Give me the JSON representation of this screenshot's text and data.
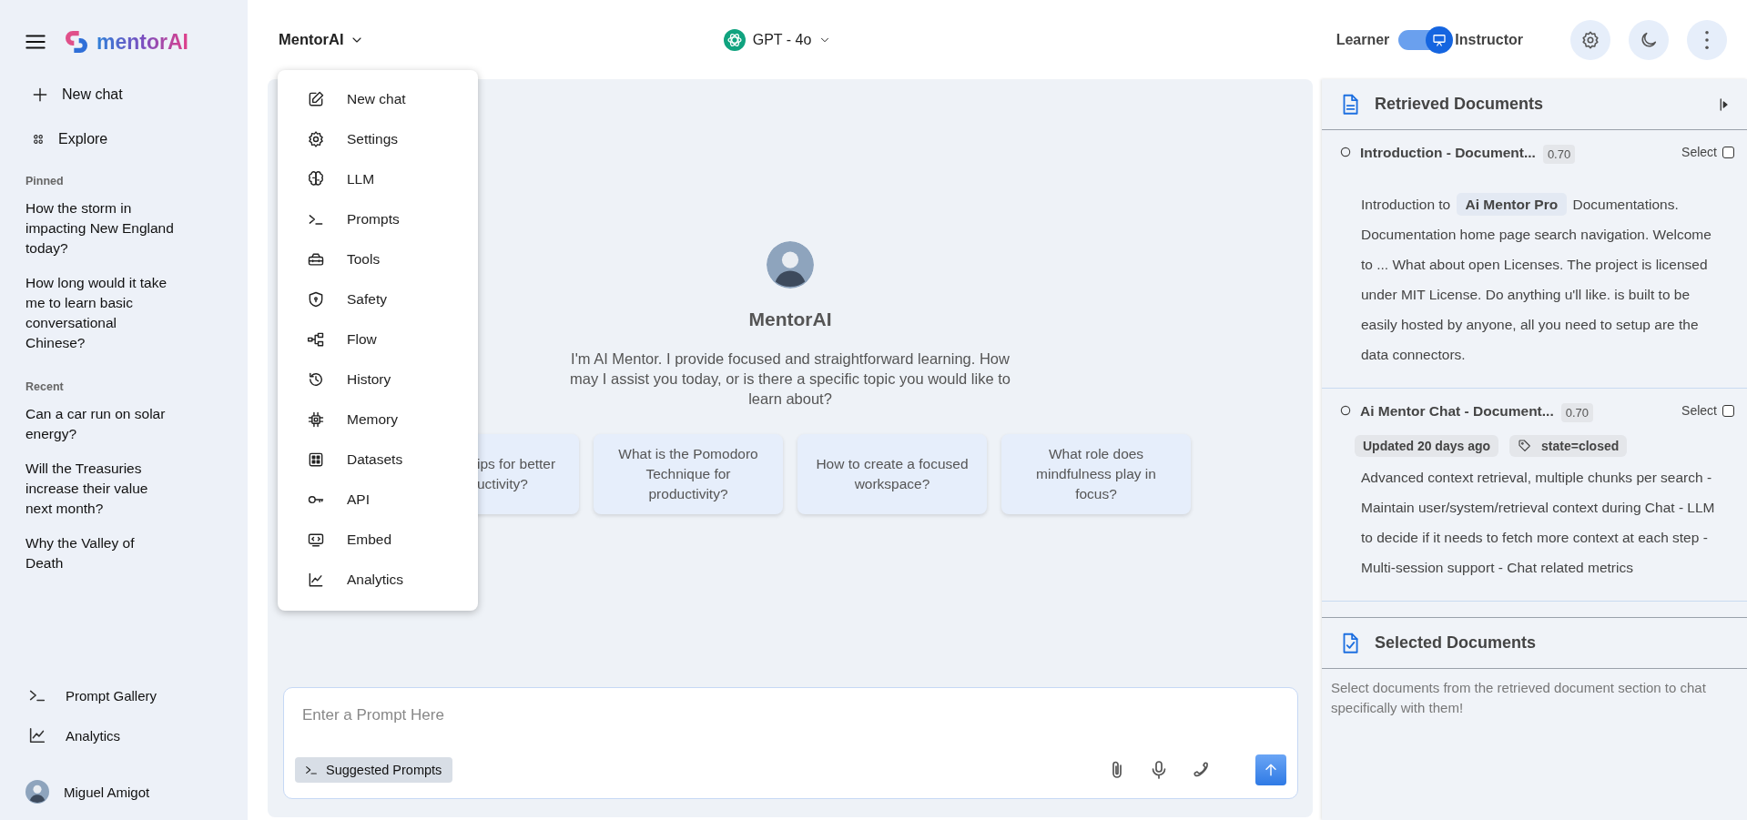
{
  "sidebar": {
    "logo": "mentorAI",
    "actions": [
      {
        "label": "New chat"
      },
      {
        "label": "Explore"
      }
    ],
    "sections": [
      {
        "title": "Pinned",
        "items": [
          {
            "label": "How the storm in impacting New England today?"
          },
          {
            "label": "How long would it take me to learn basic conversational Chinese?"
          }
        ]
      },
      {
        "title": "Recent",
        "items": [
          {
            "label": "Can a car run on solar energy?"
          },
          {
            "label": "Will the Treasuries increase their value next month?"
          },
          {
            "label": "Why the Valley of Death"
          }
        ]
      }
    ],
    "footer_links": [
      {
        "label": "Prompt Gallery"
      },
      {
        "label": "Analytics"
      }
    ],
    "user": {
      "name": "Miguel Amigot"
    }
  },
  "header": {
    "agent": "MentorAI",
    "model": "GPT - 4o",
    "mode_toggle": {
      "left_label": "Learner",
      "right_label": "Instructor",
      "on": true
    }
  },
  "agent_menu": {
    "expanded": true,
    "items": [
      {
        "label": "New chat"
      },
      {
        "label": "Settings"
      },
      {
        "label": "LLM"
      },
      {
        "label": "Prompts"
      },
      {
        "label": "Tools"
      },
      {
        "label": "Safety"
      },
      {
        "label": "Flow"
      },
      {
        "label": "History"
      },
      {
        "label": "Memory"
      },
      {
        "label": "Datasets"
      },
      {
        "label": "API"
      },
      {
        "label": "Embed"
      },
      {
        "label": "Analytics"
      }
    ]
  },
  "welcome": {
    "title": "MentorAI",
    "message": "I'm AI Mentor. I provide focused and straightforward learning. How may I assist you today, or is there a specific topic you would like to learn about?",
    "suggestions": [
      {
        "text": "ips for better uctivity?",
        "partial": true
      },
      {
        "text": "What is the Pomodoro Technique for productivity?",
        "partial": false
      },
      {
        "text": "How to create a focused workspace?",
        "partial": false
      },
      {
        "text": "What role does mindfulness play in focus?",
        "partial": false
      }
    ]
  },
  "composer": {
    "placeholder": "Enter a Prompt Here",
    "suggested_label": "Suggested Prompts"
  },
  "documents_panel": {
    "title": "Retrieved Documents",
    "documents": [
      {
        "title": "Introduction - Document...",
        "score": "0.70",
        "select_label": "Select",
        "checked": false,
        "snippet": "Introduction to **Ai Mentor Pro** Documentations. Documentation home page search navigation. Welcome to ... What about open Licenses. The project is licensed under MIT License. Do anything u'll like. is built to be easily hosted by anyone, all you need to setup are the data connectors."
      },
      {
        "title": "Ai Mentor Chat - Document...",
        "score": "0.70",
        "select_label": "Select",
        "checked": false,
        "tags": [
          {
            "text": "Updated 20 days ago",
            "kind": "plain"
          },
          {
            "text": "state=closed",
            "kind": "label"
          }
        ],
        "snippet": "Advanced context retrieval, multiple chunks per search - Maintain user/system/retrieval context during Chat - LLM to decide if it needs to fetch more context at each step - Multi-session support - Chat related metrics"
      }
    ],
    "selected": {
      "title": "Selected Documents",
      "hint": "Select documents from the retrieved document section to chat specifically with them!"
    }
  }
}
